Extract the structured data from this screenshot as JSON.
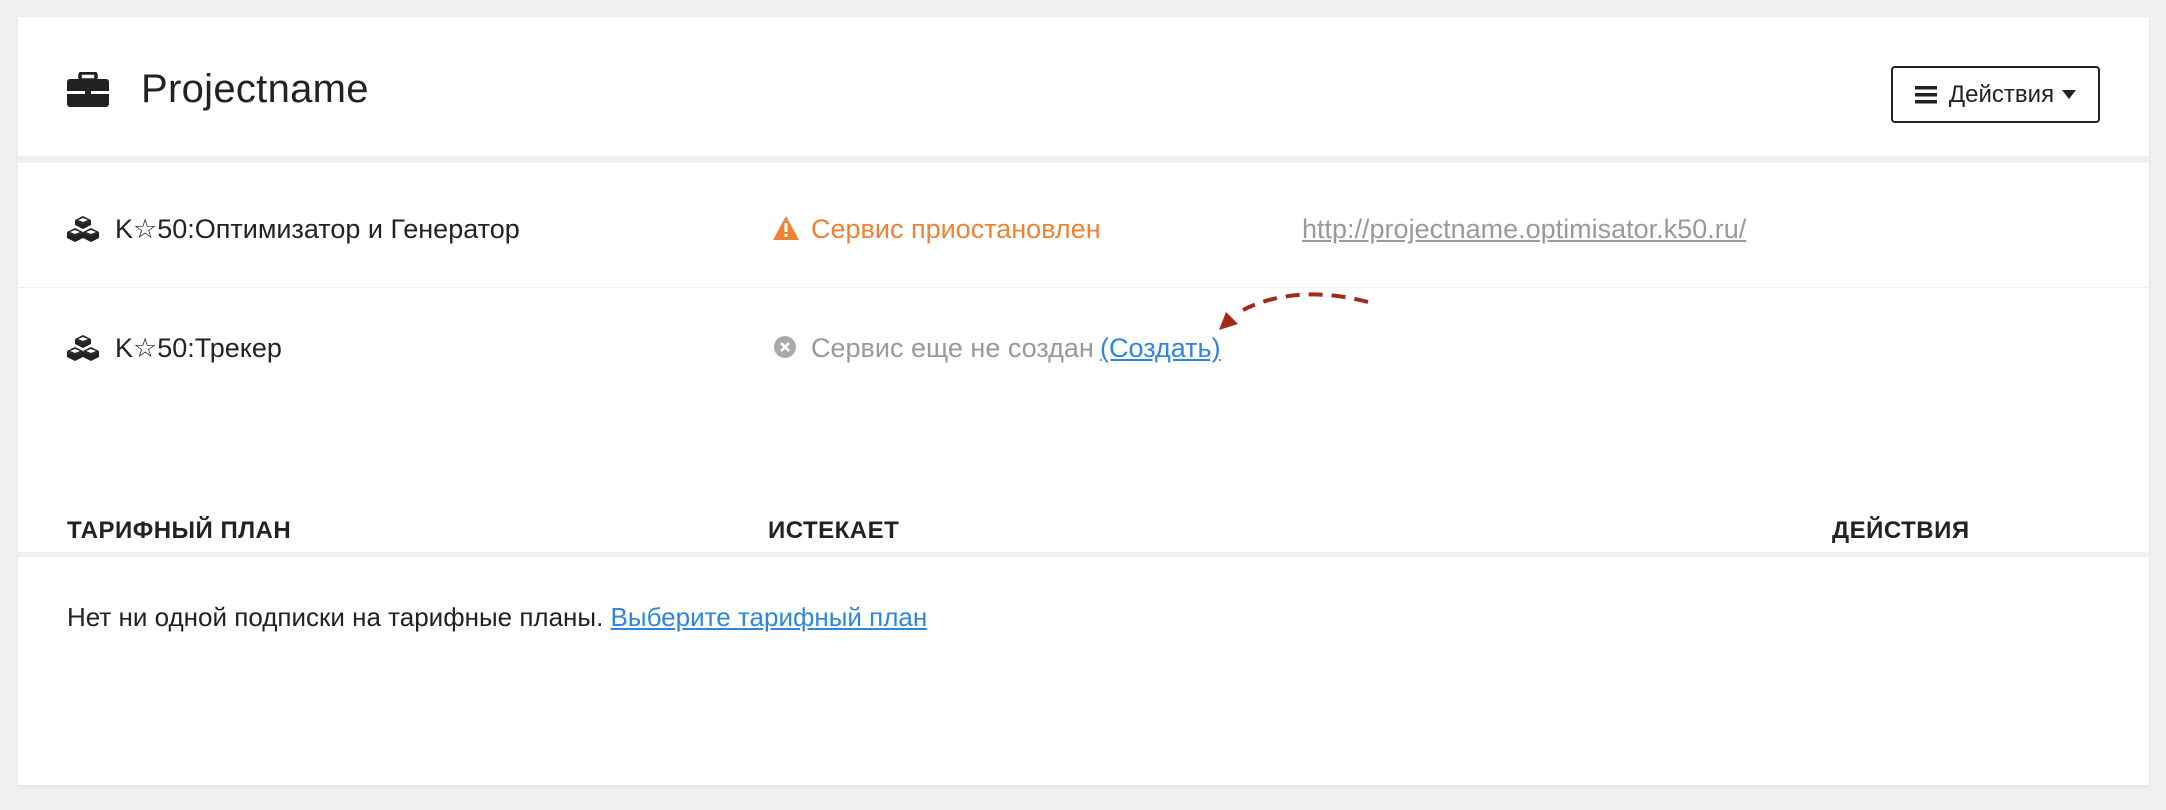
{
  "header": {
    "project_icon": "briefcase-icon",
    "title": "Projectname",
    "actions_button": {
      "icon": "bars-icon",
      "label": "Действия",
      "caret": "caret-down-icon"
    }
  },
  "services": [
    {
      "icon": "cubes-icon",
      "name": "K☆50:Оптимизатор и Генератор",
      "status_icon": "warning-icon",
      "status": "Сервис приостановлен",
      "status_color": "#ef8232",
      "url": "http://projectname.optimisator.k50.ru/"
    },
    {
      "icon": "cubes-icon",
      "name": "K☆50:Трекер",
      "status_icon": "times-circle-icon",
      "status": "Сервис еще не создан",
      "status_color": "#999999",
      "action_link": "(Создать)"
    }
  ],
  "plans": {
    "columns": [
      "ТАРИФНЫЙ ПЛАН",
      "ИСТЕКАЕТ",
      "ДЕЙСТВИЯ"
    ],
    "empty_text": "Нет ни одной подписки на тарифные планы.",
    "empty_link": "Выберите тарифный план"
  },
  "colors": {
    "accent": "#2e86de",
    "warning": "#ef8232",
    "annotation_arrow": "#a32a1a"
  }
}
